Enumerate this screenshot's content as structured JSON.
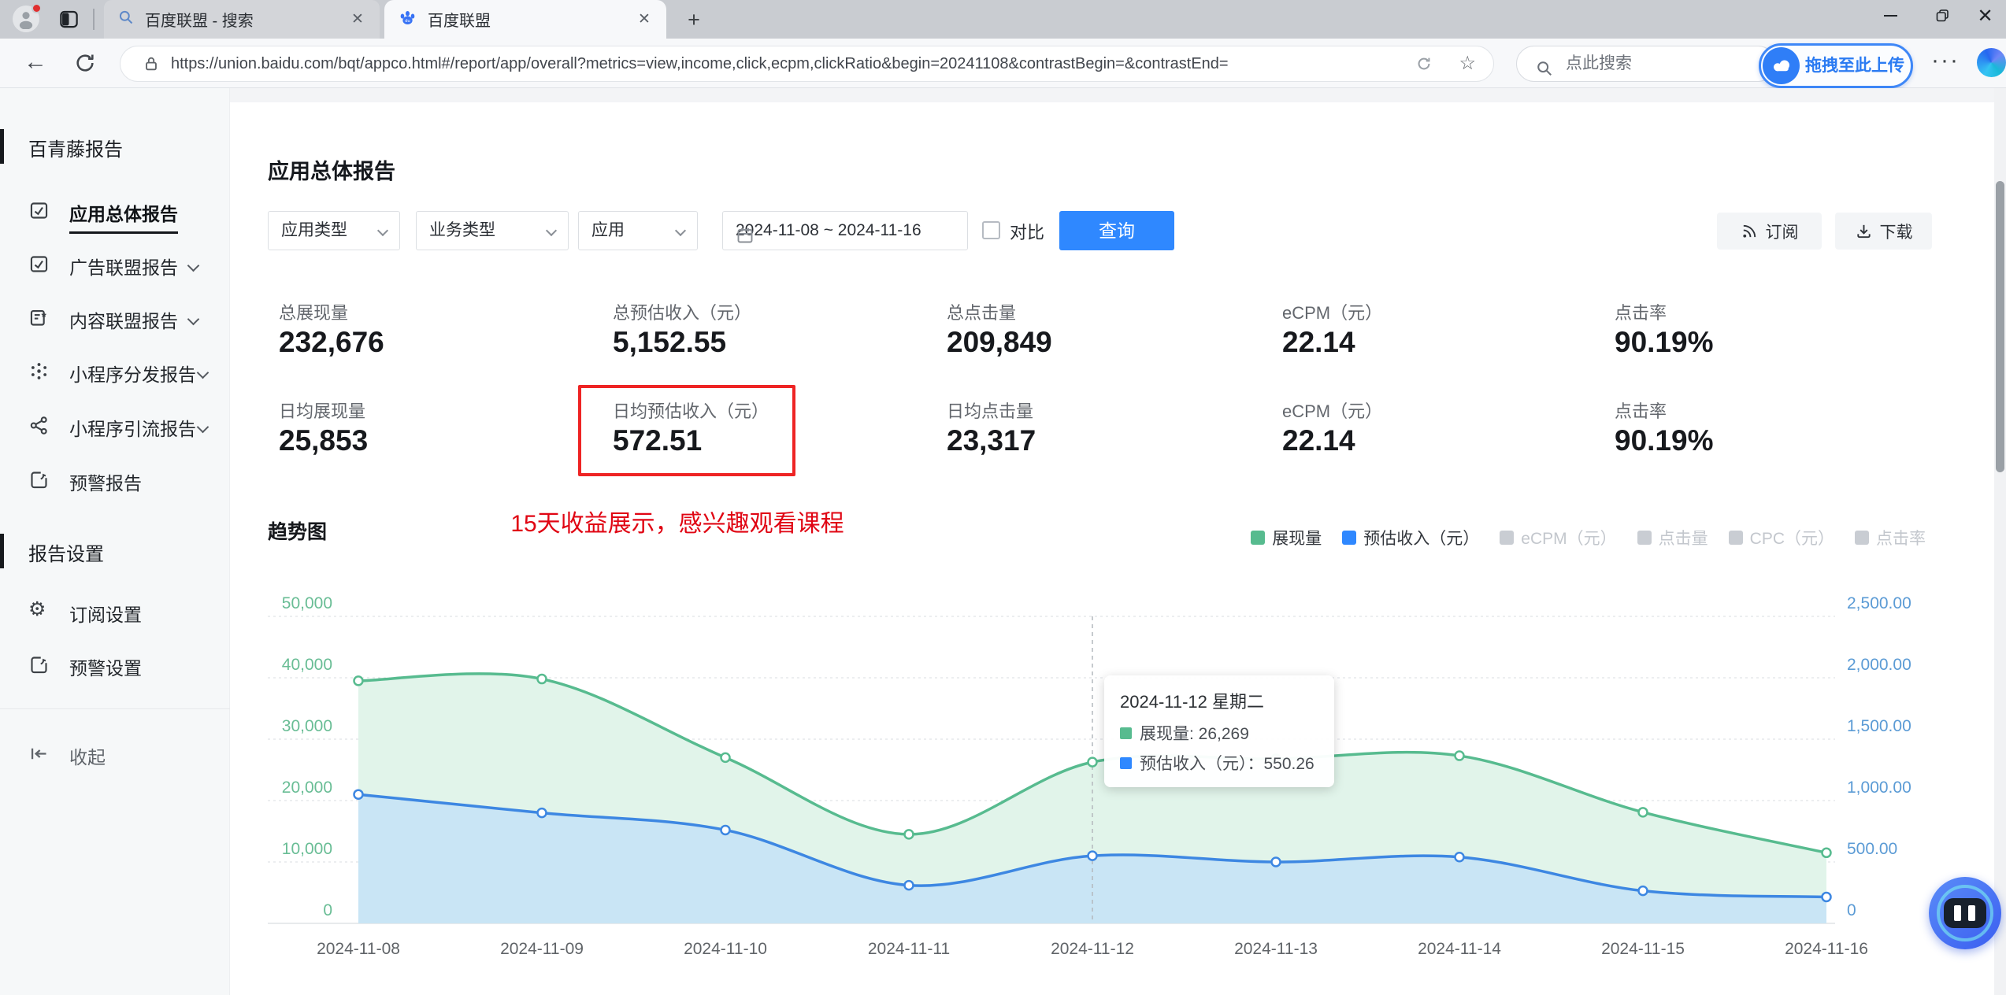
{
  "browser": {
    "tabs": [
      {
        "title": "百度联盟 - 搜索"
      },
      {
        "title": "百度联盟"
      }
    ],
    "url": "https://union.baidu.com/bqt/appco.html#/report/app/overall?metrics=view,income,click,ecpm,clickRatio&begin=20241108&contrastBegin=&contrastEnd=",
    "search_placeholder": "点此搜索",
    "upload_label": "拖拽至此上传"
  },
  "sidebar": {
    "section1": "百青藤报告",
    "items": [
      {
        "label": "应用总体报告"
      },
      {
        "label": "广告联盟报告"
      },
      {
        "label": "内容联盟报告"
      },
      {
        "label": "小程序分发报告"
      },
      {
        "label": "小程序引流报告"
      },
      {
        "label": "预警报告"
      }
    ],
    "section2": "报告设置",
    "items2": [
      {
        "label": "订阅设置"
      },
      {
        "label": "预警设置"
      }
    ],
    "collapse": "收起"
  },
  "main": {
    "title": "应用总体报告",
    "filters": {
      "app_type": "应用类型",
      "biz_type": "业务类型",
      "app": "应用",
      "date_range": "2024-11-08 ~ 2024-11-16",
      "compare": "对比",
      "query": "查询"
    },
    "actions": {
      "subscribe": "订阅",
      "download": "下载"
    },
    "stats_row1": [
      {
        "label": "总展现量",
        "value": "232,676"
      },
      {
        "label": "总预估收入（元）",
        "value": "5,152.55"
      },
      {
        "label": "总点击量",
        "value": "209,849"
      },
      {
        "label": "eCPM（元）",
        "value": "22.14"
      },
      {
        "label": "点击率",
        "value": "90.19%"
      }
    ],
    "stats_row2": [
      {
        "label": "日均展现量",
        "value": "25,853"
      },
      {
        "label": "日均预估收入（元）",
        "value": "572.51"
      },
      {
        "label": "日均点击量",
        "value": "23,317"
      },
      {
        "label": "eCPM（元）",
        "value": "22.14"
      },
      {
        "label": "点击率",
        "value": "90.19%"
      }
    ],
    "annotation": "15天收益展示，感兴趣观看课程",
    "chart_title": "趋势图"
  },
  "chart_data": {
    "type": "area",
    "title": "趋势图",
    "x": [
      "2024-11-08",
      "2024-11-09",
      "2024-11-10",
      "2024-11-11",
      "2024-11-12",
      "2024-11-13",
      "2024-11-14",
      "2024-11-15",
      "2024-11-16"
    ],
    "series": [
      {
        "name": "展现量",
        "axis": "left",
        "color": "#57bb8f",
        "fill": "#e1f4ea",
        "values": [
          39500,
          39800,
          27000,
          14500,
          26269,
          26800,
          27300,
          18100,
          11500
        ]
      },
      {
        "name": "预估收入（元）",
        "axis": "right",
        "color": "#3d87e2",
        "fill": "#c9e5f5",
        "values": [
          1050,
          900,
          760,
          310,
          550.26,
          500,
          540,
          265,
          215
        ]
      }
    ],
    "legend": [
      {
        "label": "展现量",
        "color": "#57bb8f",
        "active": true
      },
      {
        "label": "预估收入（元）",
        "color": "#2f88ff",
        "active": true
      },
      {
        "label": "eCPM（元）",
        "color": "#c9cdd3",
        "active": false
      },
      {
        "label": "点击量",
        "color": "#c9cdd3",
        "active": false
      },
      {
        "label": "CPC（元）",
        "color": "#c9cdd3",
        "active": false
      },
      {
        "label": "点击率",
        "color": "#c9cdd3",
        "active": false
      }
    ],
    "y_left": {
      "max": 50000,
      "color": "#69bd95",
      "ticks": [
        "0",
        "10,000",
        "20,000",
        "30,000",
        "40,000",
        "50,000"
      ]
    },
    "y_right": {
      "max": 2500,
      "color": "#5b9bd5",
      "ticks": [
        "0",
        "500.00",
        "1,000.00",
        "1,500.00",
        "2,000.00",
        "2,500.00"
      ]
    },
    "grid": true,
    "hover_index": 4,
    "tooltip": {
      "title": "2024-11-12 星期二",
      "rows": [
        {
          "color": "#57bb8f",
          "text": "展现量: 26,269"
        },
        {
          "color": "#2f88ff",
          "text": "预估收入（元）：550.26"
        }
      ]
    }
  }
}
